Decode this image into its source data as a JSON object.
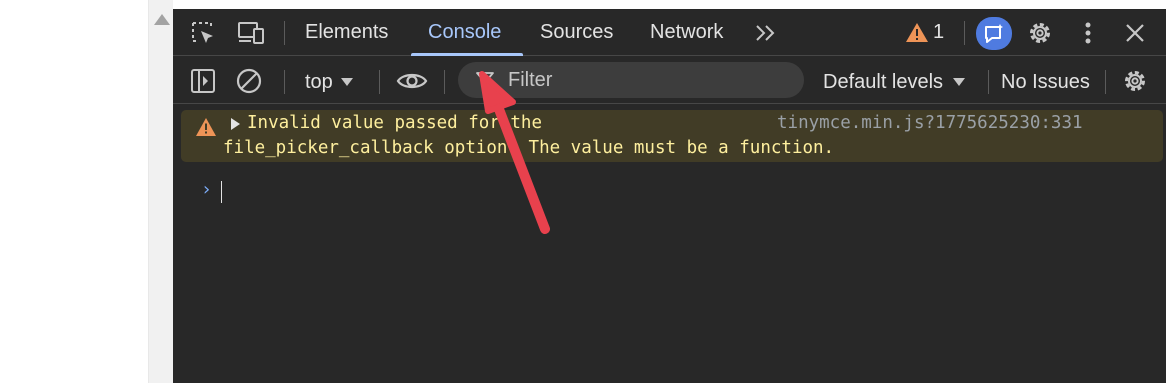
{
  "devtools": {
    "tabs": [
      {
        "label": "Elements",
        "active": false
      },
      {
        "label": "Console",
        "active": true
      },
      {
        "label": "Sources",
        "active": false
      },
      {
        "label": "Network",
        "active": false
      }
    ],
    "more_tabs_icon": "chevron-double-right-icon",
    "warning_count": "1",
    "toolbar": {
      "context": "top",
      "filter_placeholder": "Filter",
      "levels": "Default levels",
      "issues": "No Issues"
    },
    "console": {
      "message_line1": "Invalid value passed for the",
      "message_line2": "file_picker_callback option. The value must be a function.",
      "source": "tinymce.min.js?1775625230:331",
      "prompt": "›"
    }
  },
  "colors": {
    "panel_bg": "#282828",
    "active_tab": "#a8c7fa",
    "warning_bg": "#413c26",
    "warning_text": "#feef9e",
    "warning_icon": "#ee9457",
    "annotation_arrow": "#e8414d"
  }
}
